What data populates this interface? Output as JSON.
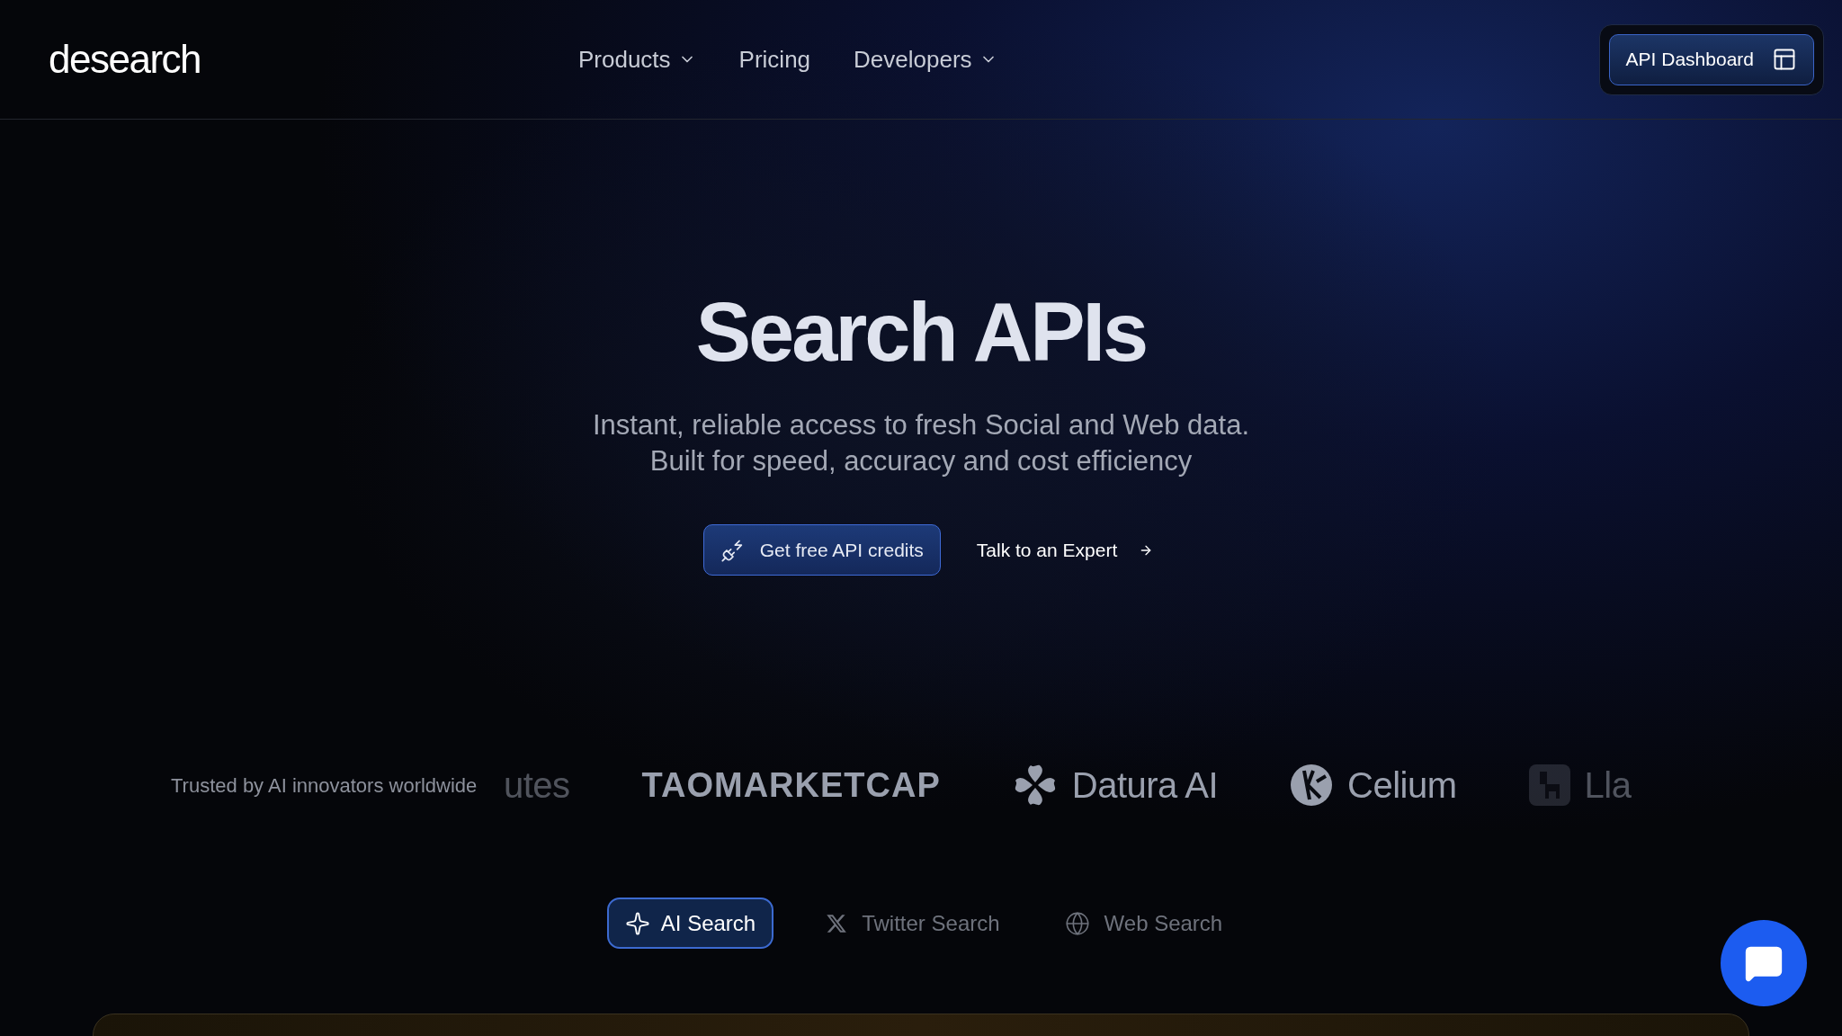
{
  "header": {
    "logo": "desearch",
    "nav": [
      {
        "label": "Products",
        "dropdown": true
      },
      {
        "label": "Pricing",
        "dropdown": false
      },
      {
        "label": "Developers",
        "dropdown": true
      }
    ],
    "dashboard_button": "API Dashboard"
  },
  "hero": {
    "title": "Search APIs",
    "subtitle_lines": [
      "Instant, reliable access to fresh Social and Web data.",
      "Built for speed, accuracy and cost efficiency"
    ],
    "primary_button": "Get free API credits",
    "secondary_link": "Talk to an Expert"
  },
  "trusted": {
    "label": "Trusted by AI innovators worldwide",
    "logos": [
      {
        "name": "utes",
        "kind": "wordmark"
      },
      {
        "name": "TAOMARKETCAP",
        "kind": "wordmark"
      },
      {
        "name": "Datura AI",
        "kind": "flower"
      },
      {
        "name": "Celium",
        "kind": "circle"
      },
      {
        "name": "Lla",
        "kind": "llama"
      }
    ]
  },
  "tabs": [
    {
      "label": "AI Search",
      "kind": "sparkle",
      "selected": true
    },
    {
      "label": "Twitter Search",
      "kind": "x",
      "selected": false
    },
    {
      "label": "Web Search",
      "kind": "globe",
      "selected": false
    }
  ]
}
